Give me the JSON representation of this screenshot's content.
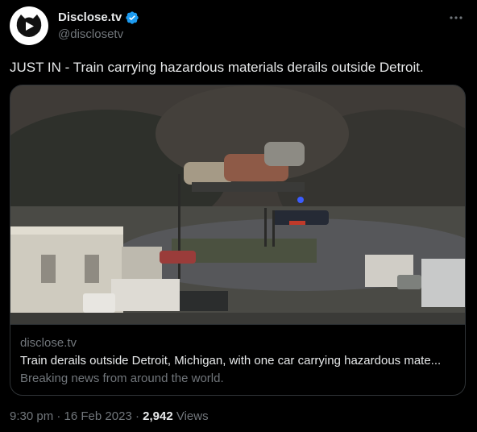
{
  "author": {
    "display_name": "Disclose.tv",
    "handle": "@disclosetv",
    "verified": true,
    "avatar_icon": "disclose-tv-logo"
  },
  "tweet": {
    "text": "JUST IN - Train carrying hazardous materials derails outside Detroit."
  },
  "card": {
    "domain": "disclose.tv",
    "title": "Train derails outside Detroit, Michigan, with one car carrying hazardous mate...",
    "description": "Breaking news from around the world."
  },
  "meta": {
    "time": "9:30 pm",
    "separator1": " · ",
    "date": "16 Feb 2023",
    "separator2": " · ",
    "views_count": "2,942",
    "views_label": " Views"
  },
  "colors": {
    "background": "#000000",
    "primary_text": "#e7e9ea",
    "secondary_text": "#71767b",
    "border": "#2f3336",
    "verified_blue": "#1d9bf0"
  }
}
